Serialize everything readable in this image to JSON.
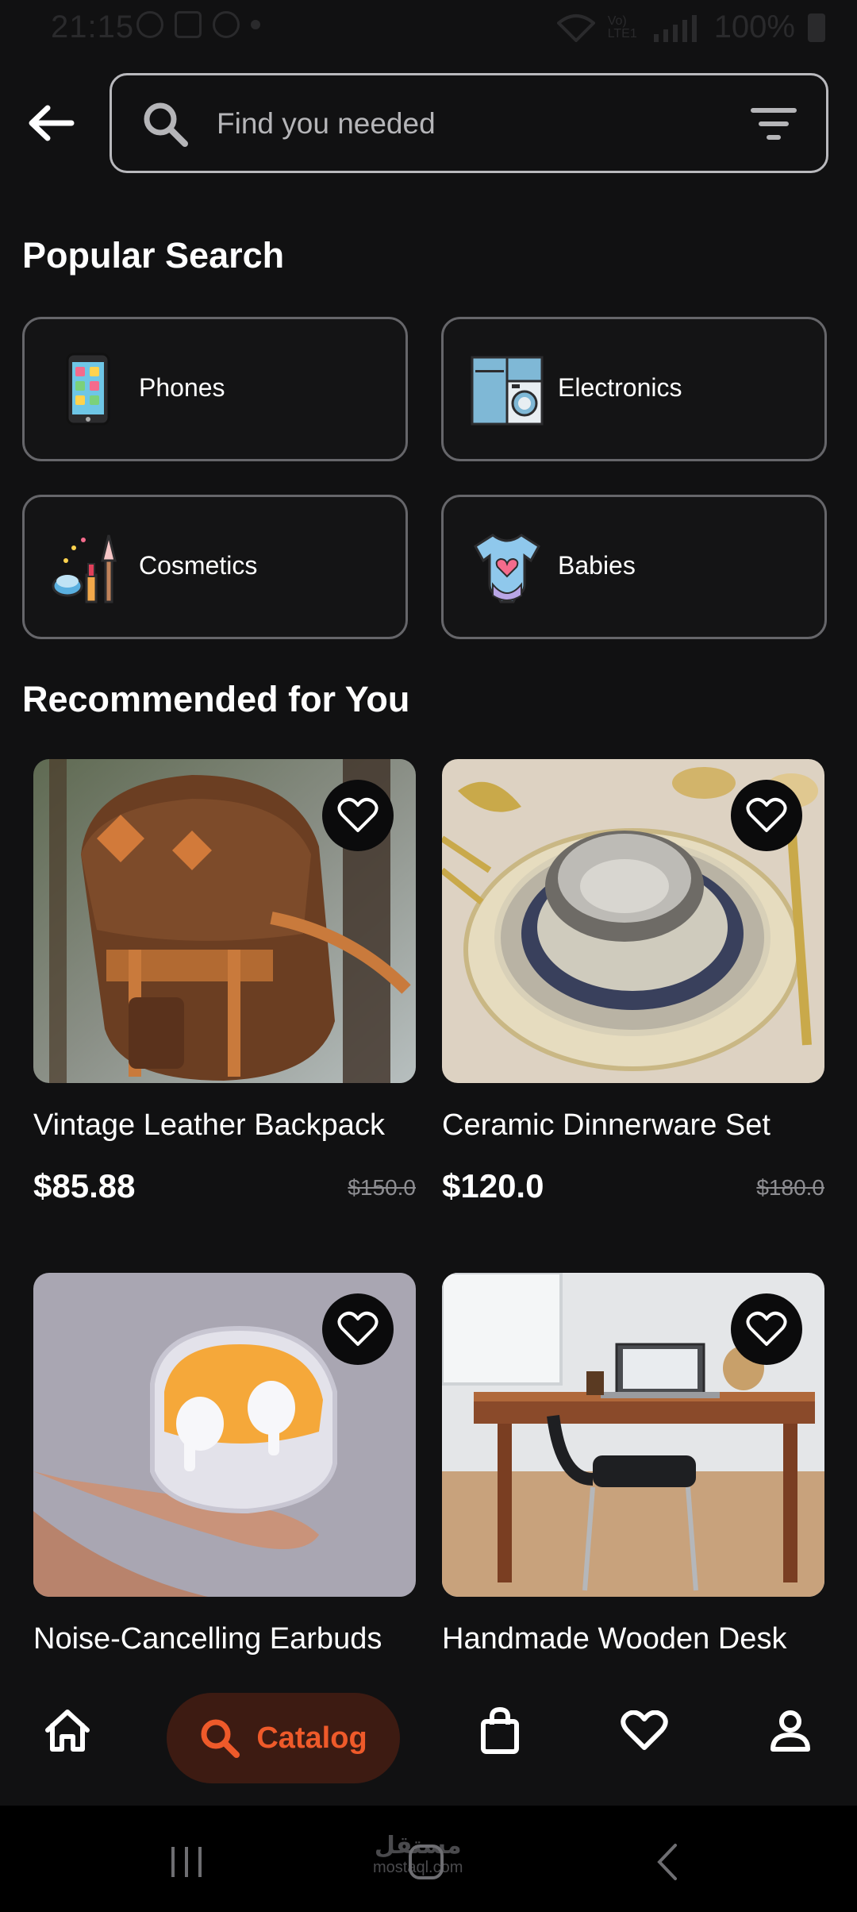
{
  "status_bar": {
    "time": "21:15",
    "network": "Vo) LTE1",
    "battery": "100%"
  },
  "search": {
    "placeholder": "Find you needed"
  },
  "popular": {
    "title": "Popular Search",
    "categories": [
      {
        "label": "Phones",
        "icon": "phone-icon"
      },
      {
        "label": "Electronics",
        "icon": "washing-machine-icon"
      },
      {
        "label": "Cosmetics",
        "icon": "cosmetics-icon"
      },
      {
        "label": "Babies",
        "icon": "baby-onesie-icon"
      }
    ]
  },
  "recommended": {
    "title": "Recommended for You",
    "products": [
      {
        "name": "Vintage Leather Backpack",
        "price": "$85.88",
        "old_price": "$150.0"
      },
      {
        "name": "Ceramic Dinnerware Set",
        "price": "$120.0",
        "old_price": "$180.0"
      },
      {
        "name": "Noise-Cancelling Earbuds",
        "price": "",
        "old_price": ""
      },
      {
        "name": "Handmade Wooden Desk",
        "price": "",
        "old_price": ""
      }
    ]
  },
  "bottom_nav": {
    "active_label": "Catalog",
    "items": [
      "home-icon",
      "search-icon",
      "shopping-bag-icon",
      "heart-icon",
      "profile-icon"
    ],
    "accent_color": "#ee5a2a"
  },
  "system_nav": {
    "watermark": "مستقل",
    "watermark_sub": "mostaql.com"
  }
}
